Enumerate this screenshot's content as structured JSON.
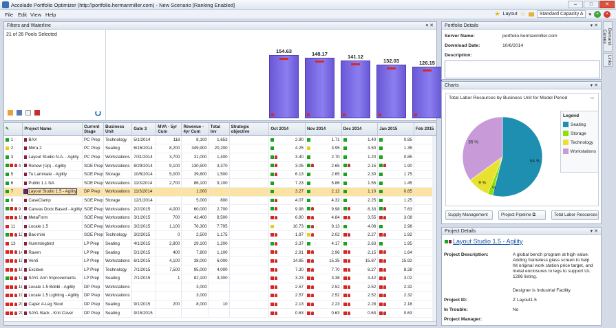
{
  "window": {
    "title": "Accolade Portfolio Optimizer (http://portfolio.hermanmiller.com) - New Scenario [Ranking Enabled]"
  },
  "menu": [
    "File",
    "Edit",
    "View",
    "Help"
  ],
  "toolbar": {
    "layout_label": "Layout",
    "scenario": "Standard Capacity A"
  },
  "filters": {
    "title": "Filters and Waterline",
    "pools_selected": "21 of 26 Pools Selected",
    "bars": [
      {
        "label": "154.63",
        "value": 154.63
      },
      {
        "label": "148.17",
        "value": 148.17
      },
      {
        "label": "141.12",
        "value": 141.12
      },
      {
        "label": "132.03",
        "value": 132.03
      },
      {
        "label": "126.15",
        "value": 126.15
      }
    ]
  },
  "grid": {
    "headers": [
      "",
      "Project Name",
      "Current Stage",
      "Business Unit",
      "Gate 3",
      "MVA - 5yr Cum",
      "Revenue - 4yr Cum",
      "Total Inv",
      "Strategic objective",
      "Oct 2014",
      "Nov 2014",
      "Dec 2014",
      "Jan 2015",
      "Feb 2015"
    ],
    "rows": [
      {
        "s": "g",
        "n": "1",
        "name": "BAX",
        "stage": "PC Prep",
        "bu": "Technology",
        "gate": "5/1/2014",
        "mva": "118",
        "rev": "8,100",
        "inv": "1,653",
        "m": [
          "2.90",
          "1.71",
          "1.40",
          "0.85"
        ],
        "c": [
          "g",
          "g",
          "g",
          "g"
        ],
        "p": [
          0,
          0,
          0,
          0
        ]
      },
      {
        "s": "y",
        "n": "2",
        "name": "Mirra 2",
        "stage": "PC Prep",
        "bu": "Seating",
        "gate": "6/16/2014",
        "mva": "8,200",
        "rev": "349,900",
        "inv": "20,200",
        "m": [
          "4.25",
          "3.95",
          "3.50",
          "1.35"
        ],
        "c": [
          "g",
          "y",
          "g",
          "g"
        ],
        "p": [
          0,
          0,
          0,
          0
        ]
      },
      {
        "s": "g",
        "n": "3",
        "name": "Layout Studio N.A. - Agility",
        "stage": "PC Prep",
        "bu": "Workstations",
        "gate": "7/31/2014",
        "mva": "3,700",
        "rev": "31,000",
        "inv": "1,400",
        "m": [
          "3.40",
          "2.70",
          "1.20",
          "0.85"
        ],
        "c": [
          "g",
          "g",
          "g",
          "g"
        ],
        "p": [
          1,
          0,
          0,
          0
        ]
      },
      {
        "s": "gr",
        "n": "4",
        "name": "Renew (Up) - Agility",
        "stage": "SOE Prep",
        "bu": "Workstations",
        "gate": "8/29/2014",
        "mva": "9,100",
        "rev": "130,500",
        "inv": "3,370",
        "m": [
          "3.05",
          "2.65",
          "2.15",
          "1.90"
        ],
        "c": [
          "g",
          "g",
          "g",
          "g"
        ],
        "p": [
          1,
          1,
          1,
          1
        ]
      },
      {
        "s": "g",
        "n": "5",
        "name": "Tu Laminate - Agility",
        "stage": "SOE Prep",
        "bu": "Storage",
        "gate": "10/6/2014",
        "mva": "5,000",
        "rev": "39,800",
        "inv": "1,500",
        "m": [
          "6.13",
          "2.65",
          "2.30",
          "1.75"
        ],
        "c": [
          "g",
          "g",
          "g",
          "g"
        ],
        "p": [
          1,
          0,
          0,
          0
        ]
      },
      {
        "s": "g",
        "n": "6",
        "name": "Public 1.1 NA",
        "stage": "SOE Prep",
        "bu": "Workstations",
        "gate": "11/3/2014",
        "mva": "2,700",
        "rev": "86,100",
        "inv": "9,100",
        "m": [
          "7.23",
          "5.86",
          "1.55",
          "1.45"
        ],
        "c": [
          "g",
          "g",
          "g",
          "g"
        ],
        "p": [
          0,
          0,
          0,
          0
        ]
      },
      {
        "s": "g",
        "n": "7",
        "name": "Layout Studio 1.5 - Agility",
        "stage": "DP Prep",
        "bu": "Workstations",
        "gate": "11/3/2014",
        "mva": "",
        "rev": "1,000",
        "inv": "",
        "m": [
          "3.27",
          "2.12",
          "1.10",
          "0.85"
        ],
        "c": [
          "g",
          "g",
          "g",
          "g"
        ],
        "p": [
          0,
          0,
          0,
          0
        ],
        "sel": true
      },
      {
        "s": "g",
        "n": "8",
        "name": "CaseClamp",
        "stage": "SOE Prep",
        "bu": "Storage",
        "gate": "12/1/2014",
        "mva": "",
        "rev": "5,000",
        "inv": "800",
        "m": [
          "4.07",
          "4.32",
          "2.25",
          "1.25"
        ],
        "c": [
          "g",
          "g",
          "g",
          "g"
        ],
        "p": [
          1,
          0,
          0,
          0
        ]
      },
      {
        "s": "gr",
        "n": "9",
        "name": "Canvas Dock Based - Agility",
        "stage": "SOE Prep",
        "bu": "Workstations",
        "gate": "2/2/2015",
        "mva": "4,000",
        "rev": "60,000",
        "inv": "2,700",
        "m": [
          "9.98",
          "9.98",
          "8.33",
          "7.63"
        ],
        "c": [
          "g",
          "g",
          "g",
          "g"
        ],
        "p": [
          1,
          1,
          1,
          1
        ]
      },
      {
        "s": "rr",
        "n": "10",
        "name": "MetaForm",
        "stage": "SOE Prep",
        "bu": "Workstations",
        "gate": "3/1/2015",
        "mva": "700",
        "rev": "42,400",
        "inv": "8,500",
        "m": [
          "6.80",
          "4.84",
          "3.55",
          "3.08"
        ],
        "c": [
          "r",
          "r",
          "r",
          "r"
        ],
        "p": [
          1,
          1,
          1,
          1
        ]
      },
      {
        "s": "r",
        "n": "11",
        "name": "Locale 1.5",
        "stage": "SOE Prep",
        "bu": "Workstations",
        "gate": "3/2/2015",
        "mva": "1,100",
        "rev": "76,300",
        "inv": "7,795",
        "m": [
          "10.73",
          "9.13",
          "4.08",
          "2.98"
        ],
        "c": [
          "y",
          "g",
          "g",
          "g"
        ],
        "p": [
          0,
          1,
          0,
          0
        ]
      },
      {
        "s": "gr",
        "n": "12",
        "name": "Bax-mini",
        "stage": "SOE Prep",
        "bu": "Technology",
        "gate": "3/2/2015",
        "mva": "0",
        "rev": "2,500",
        "inv": "1,175",
        "m": [
          "1.97",
          "2.02",
          "2.27",
          "1.92"
        ],
        "c": [
          "r",
          "y",
          "r",
          "r"
        ],
        "p": [
          1,
          1,
          1,
          1
        ]
      },
      {
        "s": "r",
        "n": "13",
        "name": "Hummingbird",
        "stage": "LP Prep",
        "bu": "Seating",
        "gate": "4/1/2015",
        "mva": "2,800",
        "rev": "29,100",
        "inv": "1,200",
        "m": [
          "3.37",
          "4.17",
          "2.63",
          "1.95"
        ],
        "c": [
          "g",
          "g",
          "g",
          "g"
        ],
        "p": [
          1,
          0,
          0,
          0
        ]
      },
      {
        "s": "rr",
        "n": "14",
        "name": "Raven",
        "stage": "LP Prep",
        "bu": "Seating",
        "gate": "5/1/2015",
        "mva": "400",
        "rev": "7,800",
        "inv": "1,100",
        "m": [
          "2.91",
          "2.96",
          "2.15",
          "1.64"
        ],
        "c": [
          "r",
          "r",
          "r",
          "r"
        ],
        "p": [
          1,
          1,
          1,
          1
        ]
      },
      {
        "s": "rr",
        "n": "15",
        "name": "Venti",
        "stage": "LP Prep",
        "bu": "Workstations",
        "gate": "6/1/2015",
        "mva": "4,100",
        "rev": "38,000",
        "inv": "6,000",
        "m": [
          "14.85",
          "15.35",
          "15.87",
          "15.92"
        ],
        "c": [
          "r",
          "r",
          "r",
          "r"
        ],
        "p": [
          1,
          1,
          1,
          1
        ]
      },
      {
        "s": "rr",
        "n": "16",
        "name": "Exclave",
        "stage": "LP Prep",
        "bu": "Technology",
        "gate": "7/1/2015",
        "mva": "7,500",
        "rev": "95,000",
        "inv": "4,000",
        "m": [
          "7.30",
          "7.70",
          "8.27",
          "8.28"
        ],
        "c": [
          "r",
          "r",
          "r",
          "r"
        ],
        "p": [
          1,
          1,
          1,
          1
        ]
      },
      {
        "s": "gr",
        "n": "17",
        "name": "SAYL Arm Improvements",
        "stage": "LP Prep",
        "bu": "Seating",
        "gate": "7/1/2015",
        "mva": "1",
        "rev": "82,100",
        "inv": "3,300",
        "m": [
          "3.23",
          "3.38",
          "3.42",
          "3.02"
        ],
        "c": [
          "r",
          "r",
          "r",
          "r"
        ],
        "p": [
          1,
          1,
          1,
          1
        ]
      },
      {
        "s": "rr",
        "n": "18",
        "name": "Locale 1.5 Bobbi - Agility",
        "stage": "DP Prep",
        "bu": "Workstations",
        "gate": "",
        "mva": "",
        "rev": "3,000",
        "inv": "",
        "m": [
          "2.57",
          "2.52",
          "2.52",
          "2.32"
        ],
        "c": [
          "r",
          "r",
          "r",
          "r"
        ],
        "p": [
          1,
          1,
          1,
          1
        ]
      },
      {
        "s": "rr",
        "n": "19",
        "name": "Locale 1.5 Lighting - Agility",
        "stage": "DP Prep",
        "bu": "Workstations",
        "gate": "",
        "mva": "",
        "rev": "3,000",
        "inv": "",
        "m": [
          "2.57",
          "2.52",
          "2.52",
          "2.32"
        ],
        "c": [
          "r",
          "r",
          "r",
          "r"
        ],
        "p": [
          1,
          1,
          1,
          1
        ]
      },
      {
        "s": "rr",
        "n": "20",
        "name": "Caper 4-Leg Stool",
        "stage": "DP Prep",
        "bu": "Seating",
        "gate": "9/1/2015",
        "mva": "200",
        "rev": "8,000",
        "inv": "10",
        "m": [
          "2.13",
          "2.23",
          "2.28",
          "2.18"
        ],
        "c": [
          "r",
          "r",
          "r",
          "r"
        ],
        "p": [
          1,
          1,
          1,
          1
        ]
      },
      {
        "s": "rr",
        "n": "21",
        "name": "SAYL Back - Knit Cover",
        "stage": "DP Prep",
        "bu": "Seating",
        "gate": "9/15/2015",
        "mva": "",
        "rev": "",
        "inv": "",
        "m": [
          "0.63",
          "0.63",
          "0.63",
          "0.63"
        ],
        "c": [
          "r",
          "r",
          "r",
          "r"
        ],
        "p": [
          1,
          1,
          1,
          1
        ]
      }
    ]
  },
  "portfolio_details": {
    "title": "Portfolio Details",
    "server_label": "Server Name:",
    "server": "portfolio.hermanmiller.com",
    "download_label": "Download Date:",
    "download": "10/6/2014",
    "desc_label": "Description:"
  },
  "charts": {
    "title": "Charts",
    "chart_title": "Total Labor Resources by Business Unit for Model Period",
    "buttons": [
      "Supply Management",
      "Project Pipeline",
      "Total Labor Resources by..."
    ]
  },
  "chart_data": {
    "type": "pie",
    "title": "Total Labor Resources by Business Unit for Model Period",
    "legend_title": "Legend",
    "slices": [
      {
        "name": "Seating",
        "value": 54,
        "label": "54 %",
        "color": "#1e8fb0"
      },
      {
        "name": "Storage",
        "value": 2,
        "label": "2 %",
        "color": "#8ee000"
      },
      {
        "name": "Technology",
        "value": 9,
        "label": "9 %",
        "color": "#e8e22e"
      },
      {
        "name": "Workstations",
        "value": 35,
        "label": "35 %",
        "color": "#c89bd8"
      }
    ]
  },
  "project_details": {
    "title": "Project Details",
    "name": "Layout Studio 1.5 - Agility",
    "desc_label": "Project Description:",
    "desc": "A global bench program at high value. Adding frameless glass screen to help hit original work station price target, and metal enclosures to legs to support UL 1286 listing.",
    "desc2": "Designer is Industrial Facility.",
    "id_label": "Project ID:",
    "id": "Z Layout1.5",
    "trouble_label": "In Trouble:",
    "trouble": "No",
    "manager_label": "Project Manager:"
  },
  "side_tabs": [
    "Demand Curves",
    "Links"
  ]
}
